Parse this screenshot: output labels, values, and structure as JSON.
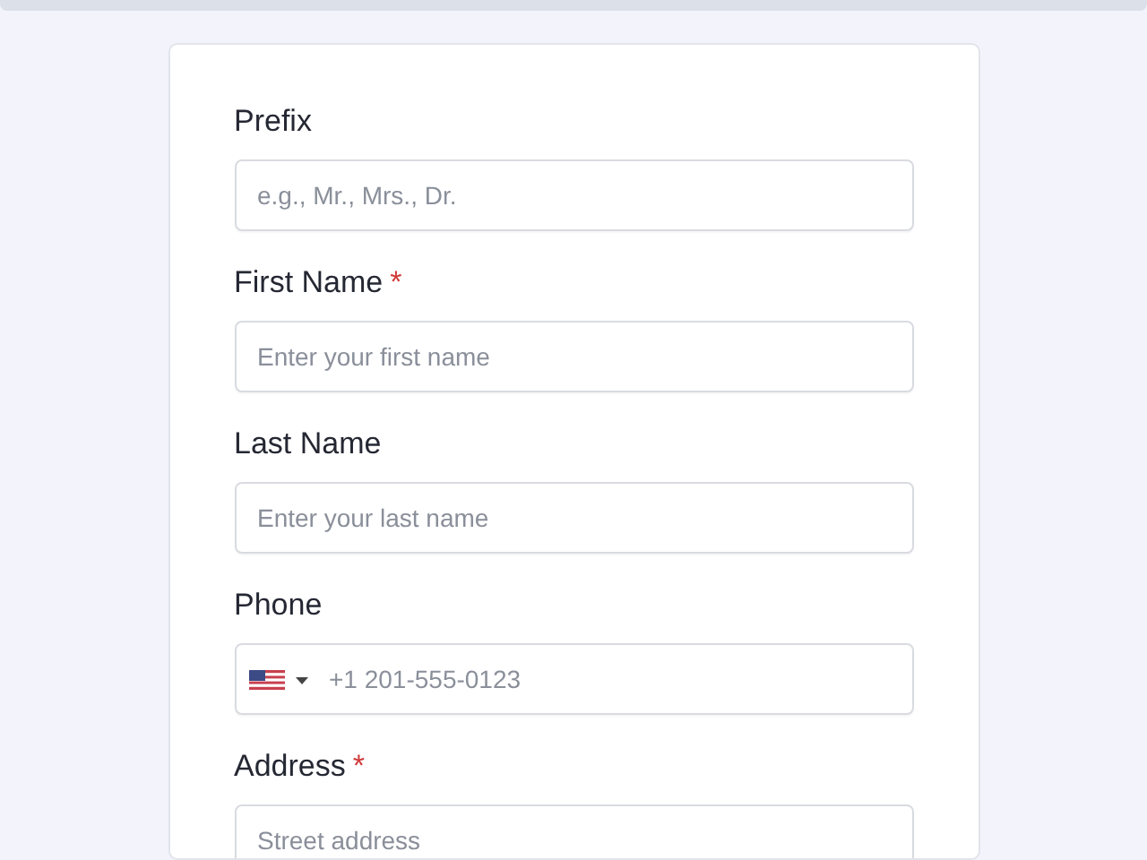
{
  "fields": [
    {
      "kind": "text",
      "label": "Prefix",
      "placeholder": "e.g., Mr., Mrs., Dr."
    },
    {
      "kind": "text",
      "label": "First Name",
      "required_mark": "*",
      "placeholder": "Enter your first name"
    },
    {
      "kind": "text",
      "label": "Last Name",
      "placeholder": "Enter your last name"
    },
    {
      "kind": "phone",
      "label": "Phone",
      "placeholder": "+1 201-555-0123"
    },
    {
      "kind": "text",
      "label": "Address",
      "required_mark": "*",
      "placeholder": "Street address"
    }
  ]
}
